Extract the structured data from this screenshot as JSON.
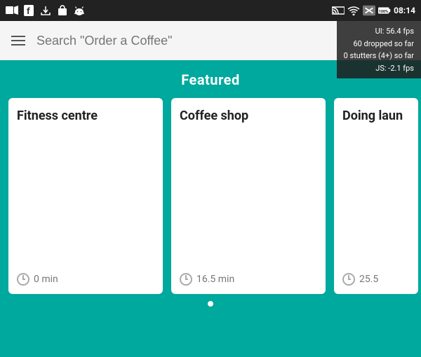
{
  "statusBar": {
    "time": "08:14",
    "batteryLevel": "100%"
  },
  "perfOverlay": {
    "line1": "UI: 56.4 fps",
    "line2": "60 dropped so far",
    "line3": "0 stutters (4+) so far",
    "line4": "JS: -2.1 fps"
  },
  "searchBar": {
    "placeholder": "Search \"Order a Coffee\""
  },
  "featured": {
    "title": "Featured",
    "cards": [
      {
        "title": "Fitness centre",
        "duration": "0 min"
      },
      {
        "title": "Coffee shop",
        "duration": "16.5 min"
      },
      {
        "title": "Doing laun",
        "duration": "25.5"
      }
    ]
  }
}
